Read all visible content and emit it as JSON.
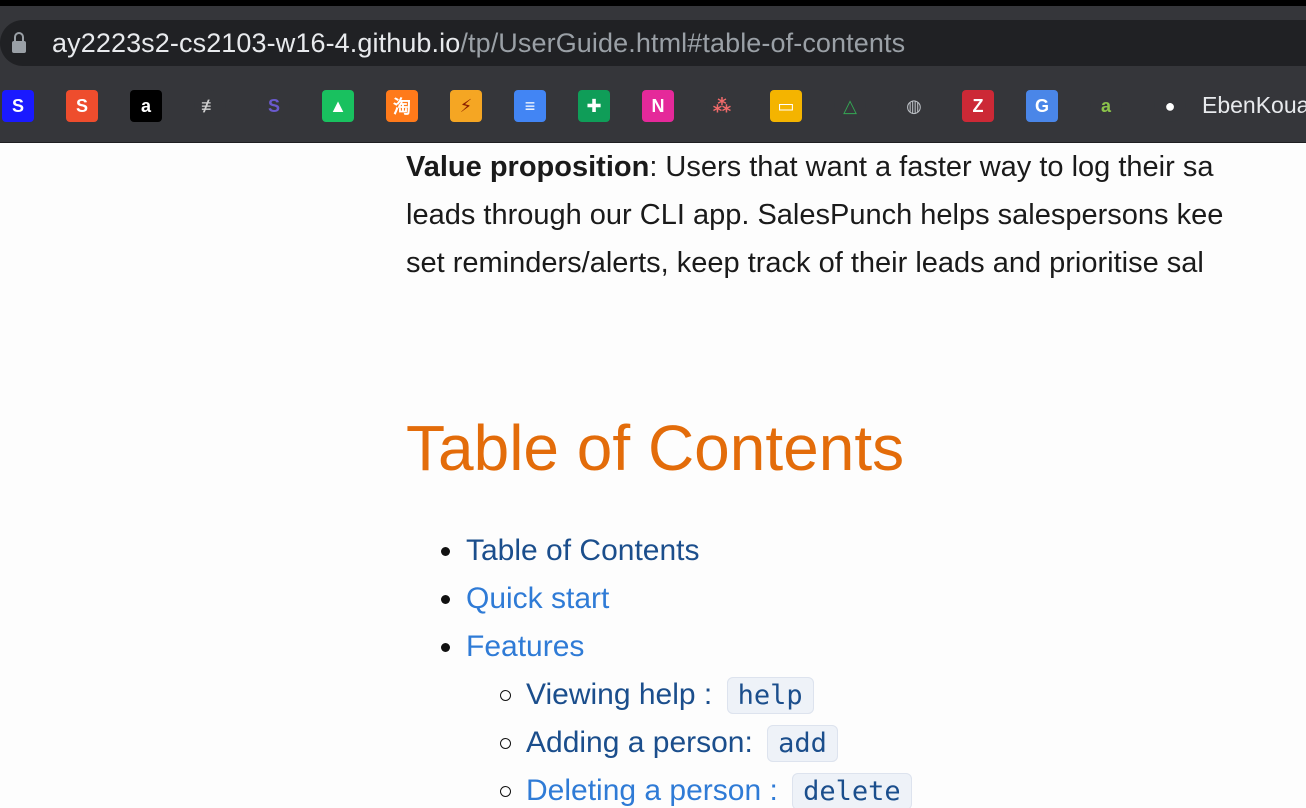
{
  "browser": {
    "url_host": "ay2223s2-cs2103-w16-4.github.io",
    "url_path": "/tp/UserGuide.html#table-of-contents",
    "bookmarks": [
      {
        "name": "shield-extension-icon",
        "glyph": "S",
        "bg": "#1a1aff",
        "fg": "#ffffff"
      },
      {
        "name": "shopee-icon",
        "glyph": "S",
        "bg": "#ee4d2d",
        "fg": "#ffffff"
      },
      {
        "name": "amazon-icon",
        "glyph": "a",
        "bg": "#000000",
        "fg": "#ffffff"
      },
      {
        "name": "tool-icon",
        "glyph": "≢",
        "bg": "#35363a",
        "fg": "#d0d0d0"
      },
      {
        "name": "purple-s-icon",
        "glyph": "S",
        "bg": "#35363a",
        "fg": "#6a5acd"
      },
      {
        "name": "green-arrow-icon",
        "glyph": "▲",
        "bg": "#19c15f",
        "fg": "#ffffff"
      },
      {
        "name": "taobao-icon",
        "glyph": "淘",
        "bg": "#ff7a1a",
        "fg": "#ffffff"
      },
      {
        "name": "pixel-icon",
        "glyph": "⚡",
        "bg": "#f5a623",
        "fg": "#8a1f00"
      },
      {
        "name": "google-docs-icon",
        "glyph": "≡",
        "bg": "#4285f4",
        "fg": "#ffffff"
      },
      {
        "name": "google-sheets-icon",
        "glyph": "✚",
        "bg": "#0f9d58",
        "fg": "#ffffff"
      },
      {
        "name": "pink-n-icon",
        "glyph": "N",
        "bg": "#e5299a",
        "fg": "#ffffff"
      },
      {
        "name": "asana-icon",
        "glyph": "⁂",
        "bg": "#35363a",
        "fg": "#f06a6a"
      },
      {
        "name": "google-slides-icon",
        "glyph": "▭",
        "bg": "#f4b400",
        "fg": "#ffffff"
      },
      {
        "name": "google-drive-icon",
        "glyph": "△",
        "bg": "#35363a",
        "fg": "#34a853"
      },
      {
        "name": "globe-icon",
        "glyph": "◍",
        "bg": "#35363a",
        "fg": "#bdc1c6"
      },
      {
        "name": "zotero-icon",
        "glyph": "Z",
        "bg": "#cc2936",
        "fg": "#ffffff"
      },
      {
        "name": "google-translate-icon",
        "glyph": "G",
        "bg": "#4a86e8",
        "fg": "#ffffff"
      },
      {
        "name": "green-a-icon",
        "glyph": "a",
        "bg": "#35363a",
        "fg": "#8bc34a"
      },
      {
        "name": "github-icon",
        "glyph": "●",
        "bg": "#35363a",
        "fg": "#ffffff"
      }
    ],
    "github_bookmark_label": "EbenKoua"
  },
  "page": {
    "value_prop_label": "Value proposition",
    "value_prop_line1": ": Users that want a faster way to log their sa",
    "value_prop_line2": "leads through our CLI app. SalesPunch helps salespersons kee",
    "value_prop_line3": "set reminders/alerts, keep track of their leads and prioritise sal",
    "toc_heading": "Table of Contents",
    "toc_items": [
      "Table of Contents",
      "Quick start",
      "Features"
    ],
    "feature_items": [
      {
        "label": "Viewing help : ",
        "code": "help"
      },
      {
        "label": "Adding a person: ",
        "code": "add"
      },
      {
        "label": "Deleting a person : ",
        "code": "delete"
      }
    ]
  }
}
